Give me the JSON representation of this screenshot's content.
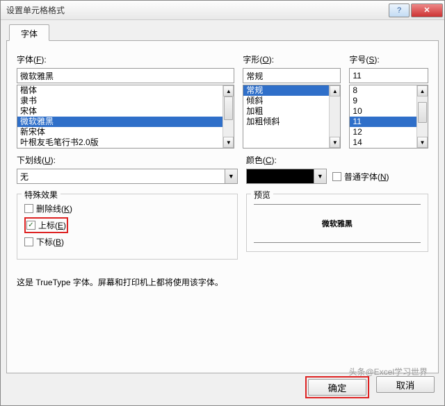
{
  "window": {
    "title": "设置单元格格式"
  },
  "tab": {
    "label": "字体"
  },
  "font": {
    "label": "字体(F):",
    "value": "微软雅黑",
    "items": [
      "楷体",
      "隶书",
      "宋体",
      "微软雅黑",
      "新宋体",
      "叶根友毛笔行书2.0版"
    ],
    "selected_index": 3
  },
  "style": {
    "label": "字形(O):",
    "value": "常规",
    "items": [
      "常规",
      "倾斜",
      "加粗",
      "加粗倾斜"
    ],
    "selected_index": 0
  },
  "size": {
    "label": "字号(S):",
    "value": "11",
    "items": [
      "8",
      "9",
      "10",
      "11",
      "12",
      "14"
    ],
    "selected_index": 3
  },
  "underline": {
    "label": "下划线(U):",
    "value": "无"
  },
  "color": {
    "label": "颜色(C):",
    "value": "#000000"
  },
  "normal_font": {
    "label": "普通字体(N)",
    "checked": false
  },
  "effects": {
    "legend": "特殊效果",
    "strike": {
      "label": "删除线(K)",
      "checked": false
    },
    "superscript": {
      "label": "上标(E)",
      "checked": true
    },
    "subscript": {
      "label": "下标(B)",
      "checked": false
    }
  },
  "preview": {
    "legend": "预览",
    "sample": "微软雅黑"
  },
  "description": "这是 TrueType 字体。屏幕和打印机上都将使用该字体。",
  "buttons": {
    "ok": "确定",
    "cancel": "取消"
  },
  "watermark": "头条@Excel学习世界"
}
